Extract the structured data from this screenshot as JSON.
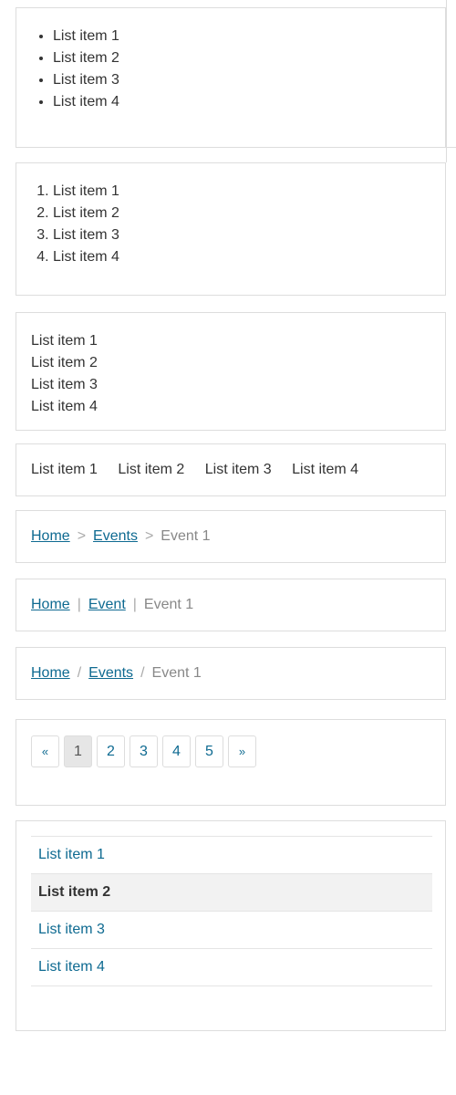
{
  "bullet_list": [
    "List item 1",
    "List item 2",
    "List item 3",
    "List item 4"
  ],
  "ordered_list": [
    "List item 1",
    "List item 2",
    "List item 3",
    "List item 4"
  ],
  "plain_list": [
    "List item 1",
    "List item 2",
    "List item 3",
    "List item 4"
  ],
  "inline_list": [
    "List item 1",
    "List item 2",
    "List item 3",
    "List item 4"
  ],
  "breadcrumb_arrow": {
    "separator": ">",
    "items": [
      "Home",
      "Events"
    ],
    "current": "Event 1"
  },
  "breadcrumb_pipe": {
    "separator": "|",
    "items": [
      "Home",
      "Event"
    ],
    "current": "Event 1"
  },
  "breadcrumb_slash": {
    "separator": "/",
    "items": [
      "Home",
      "Events"
    ],
    "current": "Event 1"
  },
  "pagination": {
    "prev": "«",
    "next": "»",
    "pages": [
      "1",
      "2",
      "3",
      "4",
      "5"
    ],
    "active_page": "1"
  },
  "nav_list": {
    "items": [
      "List item 1",
      "List item 2",
      "List item 3",
      "List item 4"
    ],
    "active_item": "List item 2"
  },
  "colors": {
    "link": "#0e6a91",
    "border": "#dddddd",
    "active_bg": "#f2f2f2"
  }
}
